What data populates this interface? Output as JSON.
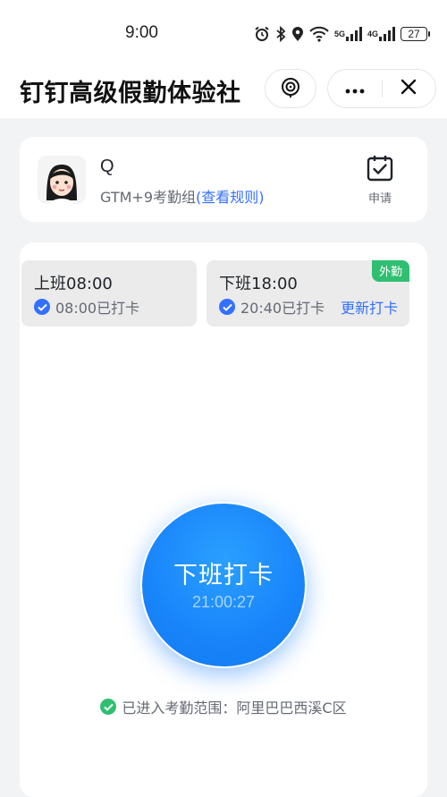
{
  "status_bar": {
    "time": "9:00",
    "network_1": "5G",
    "network_2": "4G",
    "battery": "27",
    "icons": [
      "alarm-icon",
      "bluetooth-icon",
      "location-icon",
      "wifi-icon",
      "signal-icon",
      "signal-icon",
      "battery-icon"
    ]
  },
  "header": {
    "title": "钉钉高级假勤体验社",
    "icons": [
      "miniapp-icon",
      "more-icon",
      "close-icon"
    ]
  },
  "user": {
    "name": "Q",
    "group_text": "GTM+9考勤组",
    "rules_link": "(查看规则)",
    "apply_label": "申请",
    "apply_icon": "calendar-check-icon"
  },
  "shifts": [
    {
      "title": "上班08:00",
      "status": "08:00已打卡"
    },
    {
      "title": "下班18:00",
      "status": "20:40已打卡",
      "action": "更新打卡",
      "badge": "外勤"
    }
  ],
  "punch": {
    "label": "下班打卡",
    "time": "21:00:27"
  },
  "location": {
    "text": "已进入考勤范围：阿里巴巴西溪C区"
  },
  "colors": {
    "primary": "#3370ff",
    "button": "#1a86fb",
    "success": "#2fbf71",
    "text_secondary": "#646a73"
  }
}
